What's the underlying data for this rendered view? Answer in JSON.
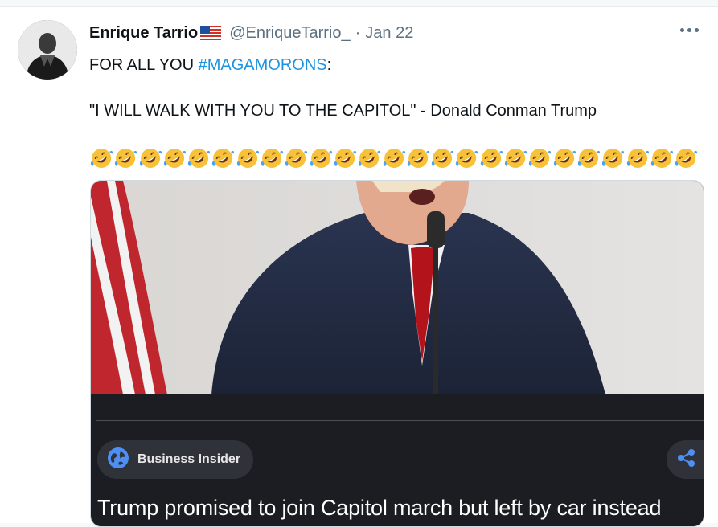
{
  "tweet": {
    "author_name": "Enrique Tarrio",
    "handle": "@EnriqueTarrio_",
    "separator": "·",
    "date": "Jan 22",
    "line1_prefix": "FOR ALL YOU ",
    "hashtag": "#MAGAMORONS",
    "line1_suffix": ":",
    "line2": "\"I WILL WALK WITH YOU TO THE CAPITOL\" - Donald Conman Trump",
    "emoji_name": "rolling-on-the-floor-laughing",
    "emoji_count": 25,
    "author_badge_icon": "us-flag-icon"
  },
  "card": {
    "source": "Business Insider",
    "headline": "Trump promised to join Capitol march but left by car instead"
  },
  "colors": {
    "hashtag": "#1b95e0",
    "card_bg": "#1b1d22",
    "pill_bg": "#2f3238"
  }
}
